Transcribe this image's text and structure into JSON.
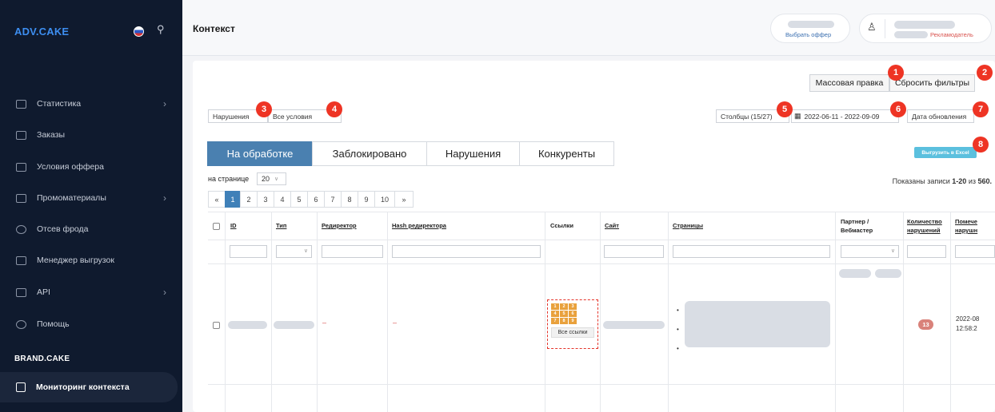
{
  "sidebar": {
    "logo": "ADV.CAKE",
    "items": [
      {
        "label": "Статистика",
        "icon": "chart-icon",
        "chevron": true
      },
      {
        "label": "Заказы",
        "icon": "cart-icon",
        "chevron": false
      },
      {
        "label": "Условия оффера",
        "icon": "document-icon",
        "chevron": false
      },
      {
        "label": "Промоматериалы",
        "icon": "gift-icon",
        "chevron": true
      },
      {
        "label": "Отсев фрода",
        "icon": "shield-icon",
        "chevron": false
      },
      {
        "label": "Менеджер выгрузок",
        "icon": "download-icon",
        "chevron": false
      },
      {
        "label": "API",
        "icon": "api-icon",
        "chevron": true
      },
      {
        "label": "Помощь",
        "icon": "help-icon",
        "chevron": false
      }
    ],
    "section_title": "BRAND.CAKE",
    "active_item": "Мониторинг контекста"
  },
  "header": {
    "title": "Контекст",
    "offer_link": "Выбрать оффер",
    "role": "Рекламодатель"
  },
  "toolbar": {
    "mass_edit": "Массовая правка",
    "reset_filters": "Сбросить фильтры",
    "violations_select": "Нарушения",
    "conditions_select": "Все условия",
    "columns_select": "Столбцы (15/27)",
    "date_range": "2022-06-11 - 2022-09-09",
    "date_type": "Дата обновления",
    "export": "Выгрузить в Excel"
  },
  "tabs": [
    "На обработке",
    "Заблокировано",
    "Нарушения",
    "Конкуренты"
  ],
  "per_page": {
    "label": "на странице",
    "value": "20"
  },
  "pagination": [
    "«",
    "1",
    "2",
    "3",
    "4",
    "5",
    "6",
    "7",
    "8",
    "9",
    "10",
    "»"
  ],
  "records": {
    "prefix": "Показаны записи ",
    "range": "1-20",
    "mid": " из ",
    "total": "560."
  },
  "table": {
    "headers": {
      "id": "ID",
      "type": "Тип",
      "redirector": "Редиректор",
      "hash": "Hash редиректора",
      "links": "Ссылки",
      "site": "Сайт",
      "pages": "Страницы",
      "partner": "Партнер / Вебмастер",
      "count": "Количество нарушений",
      "marked": "Помече нарушн"
    },
    "row": {
      "redirector": "–",
      "hash": "–",
      "links_cells": [
        "1",
        "2",
        "3",
        "4",
        "5",
        "6",
        "7",
        "8",
        "9"
      ],
      "links_button": "Все ссылки",
      "count": "13",
      "date": "2022-08",
      "time": "12:58:2"
    }
  },
  "annotations": [
    "1",
    "2",
    "3",
    "4",
    "5",
    "6",
    "7",
    "8"
  ]
}
